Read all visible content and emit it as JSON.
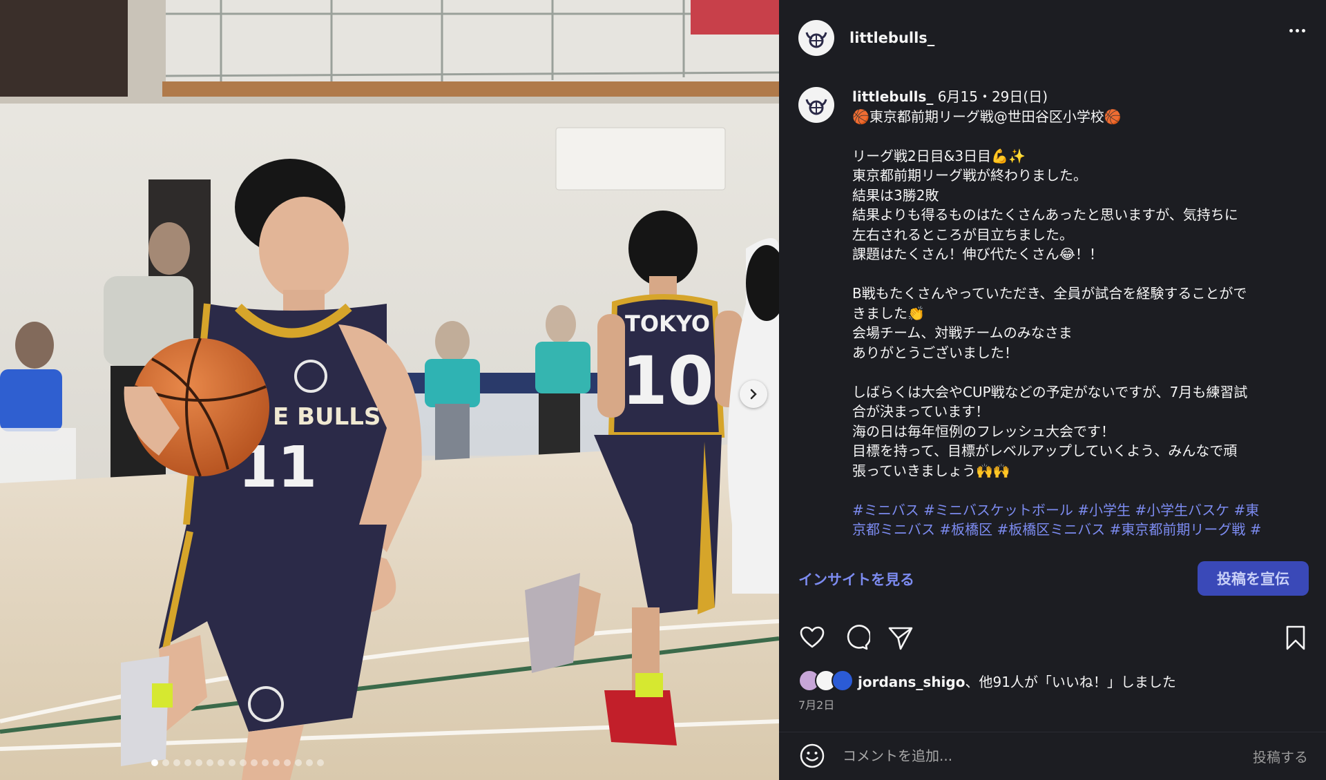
{
  "post": {
    "username": "littlebulls_",
    "caption_user": "littlebulls_",
    "caption_lines": [
      "6月15・29日(日)",
      "🏀東京都前期リーグ戦@世田谷区小学校🏀",
      "",
      "リーグ戦2日目&3日目💪✨",
      "東京都前期リーグ戦が終わりました。",
      "結果は3勝2敗",
      "結果よりも得るものはたくさんあったと思いますが、気持ちに",
      "左右されるところが目立ちました。",
      "課題はたくさん！伸び代たくさん😂！！",
      "",
      "B戦もたくさんやっていただき、全員が試合を経験することがで",
      "きました👏",
      "会場チーム、対戦チームのみなさま",
      "ありがとうございました！",
      "",
      "しばらくは大会やCUP戦などの予定がないですが、7月も練習試",
      "合が決まっています！",
      "海の日は毎年恒例のフレッシュ大会です！",
      "目標を持って、目標がレベルアップしていくよう、みんなで頑",
      "張っていきましょう🙌🙌"
    ],
    "hashtags_line1": "#ミニバス #ミニバスケットボール #小学生 #小学生バスケ #東",
    "hashtags_line2": "京都ミニバス #板橋区 #板橋区ミニバス #東京都前期リーグ戦 #",
    "insights_label": "インサイトを見る",
    "promote_label": "投稿を宣伝",
    "likes_user": "jordans_shigo",
    "likes_text": "、他91人が「いいね！」しました",
    "date": "7月2日",
    "comment_placeholder": "コメントを追加...",
    "post_button": "投稿する"
  },
  "photo": {
    "jersey_number_front": "11",
    "jersey_number_back": "10",
    "jersey_team_front": "E BULLS",
    "jersey_team_back": "TOKYO",
    "carousel_count": 16,
    "carousel_active_index": 0
  },
  "icons": {
    "avatar": "bull-logo-icon",
    "more": "more-dots-icon",
    "next": "chevron-right-icon",
    "like": "heart-icon",
    "comment": "comment-bubble-icon",
    "share": "send-icon",
    "save": "bookmark-icon",
    "emoji": "smiley-icon"
  },
  "colors": {
    "panel_bg": "#1c1d22",
    "accent": "#7c8bf0",
    "promote_bg": "#3a49b8",
    "jersey": "#2b2a48",
    "jersey_trim": "#d6a52a"
  }
}
